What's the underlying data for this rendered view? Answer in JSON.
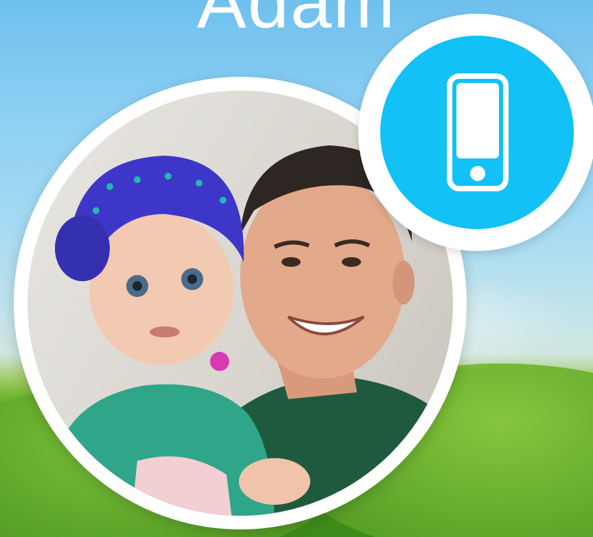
{
  "contact": {
    "name": "Adam"
  },
  "photo": {
    "icon": "contact-photo"
  },
  "call_button": {
    "icon": "phone-icon",
    "color": "#12c1f5"
  },
  "colors": {
    "sky": "#8dd0f3",
    "grass": "#5ea62a",
    "ring": "#ffffff"
  }
}
